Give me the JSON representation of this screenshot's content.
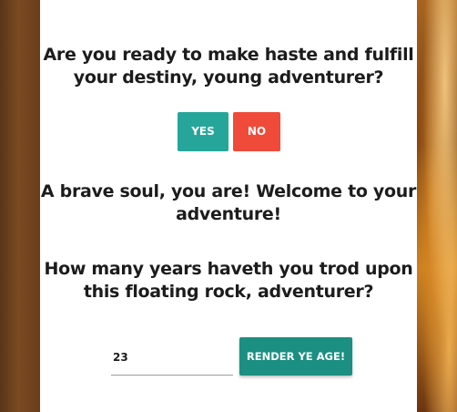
{
  "prompt": {
    "question": "Are you ready to make haste and fulfill your destiny, young adventurer?",
    "yes_label": "YES",
    "no_label": "NO"
  },
  "response": {
    "message": "A brave soul, you are! Welcome to your adventure!"
  },
  "age_form": {
    "question": "How many years haveth you trod upon this floating rock, adventurer?",
    "age_value": "23",
    "submit_label": "RENDER YE AGE!"
  },
  "colors": {
    "yes": "#26a69a",
    "no": "#ef4a3a",
    "submit": "#1b8f81",
    "panel": "#ffffff",
    "text": "#1c1c1c"
  }
}
